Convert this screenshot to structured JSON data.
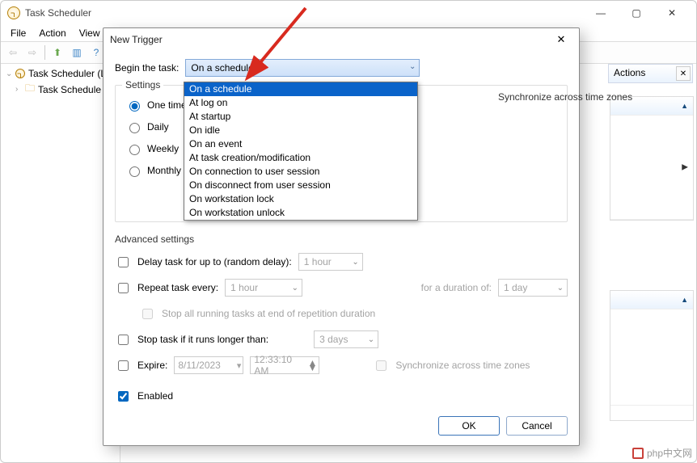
{
  "main_window": {
    "title": "Task Scheduler",
    "menu": {
      "file": "File",
      "action": "Action",
      "view": "View"
    },
    "tree": {
      "root": "Task Scheduler (L",
      "child": "Task Schedule"
    },
    "actions_header": "Actions"
  },
  "dialog": {
    "title": "New Trigger",
    "begin_label": "Begin the task:",
    "begin_value": "On a schedule",
    "settings_group": "Settings",
    "radios": {
      "one_time": "One time",
      "daily": "Daily",
      "weekly": "Weekly",
      "monthly": "Monthly"
    },
    "sync_across": "Synchronize across time zones",
    "advanced_header": "Advanced settings",
    "delay_label": "Delay task for up to (random delay):",
    "delay_value": "1 hour",
    "repeat_label": "Repeat task every:",
    "repeat_value": "1 hour",
    "duration_label": "for a duration of:",
    "duration_value": "1 day",
    "stop_running_label": "Stop all running tasks at end of repetition duration",
    "stop_if_longer_label": "Stop task if it runs longer than:",
    "stop_if_longer_value": "3 days",
    "expire_label": "Expire:",
    "expire_date": "8/11/2023",
    "expire_time": "12:33:10 AM",
    "sync_across2": "Synchronize across time zones",
    "enabled_label": "Enabled",
    "ok": "OK",
    "cancel": "Cancel"
  },
  "dropdown": {
    "items": [
      "On a schedule",
      "At log on",
      "At startup",
      "On idle",
      "On an event",
      "At task creation/modification",
      "On connection to user session",
      "On disconnect from user session",
      "On workstation lock",
      "On workstation unlock"
    ]
  },
  "watermark": "php中文网",
  "colors": {
    "accent": "#0067c0",
    "highlight": "#0a63c9",
    "arrow": "#d82a1f"
  }
}
